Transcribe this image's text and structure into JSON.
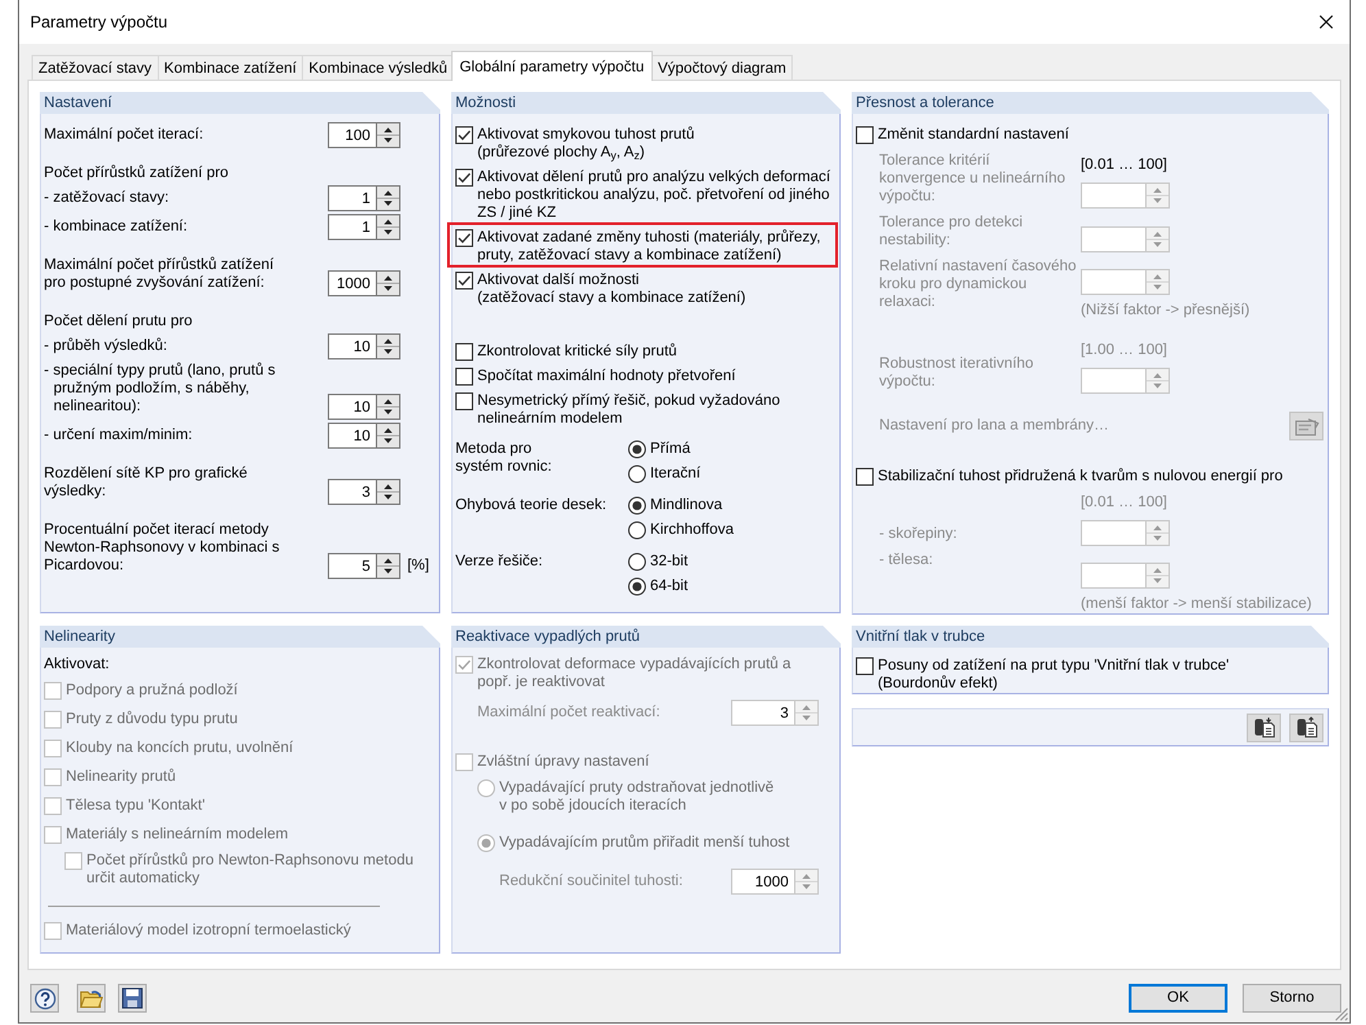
{
  "window": {
    "title": "Parametry výpočtu"
  },
  "tabs": [
    {
      "label": "Zatěžovací stavy",
      "selected": false
    },
    {
      "label": "Kombinace zatížení",
      "selected": false
    },
    {
      "label": "Kombinace výsledků",
      "selected": false
    },
    {
      "label": "Globální parametry výpočtu",
      "selected": true
    },
    {
      "label": "Výpočtový diagram",
      "selected": false
    }
  ],
  "settings": {
    "title": "Nastavení",
    "groups": [
      [
        {
          "kind": "spin",
          "label": "Maximální počet iterací:",
          "value": "100"
        }
      ],
      [
        {
          "kind": "heading",
          "label": "Počet přírůstků zatížení pro"
        },
        {
          "kind": "spin",
          "label": "- zatěžovací stavy:",
          "value": "1"
        },
        {
          "kind": "spin",
          "label": "- kombinace zatížení:",
          "value": "1"
        }
      ],
      [
        {
          "kind": "spin",
          "label": "Maximální počet přírůstků zatížení\npro postupné zvyšování zatížení:",
          "value": "1000"
        }
      ],
      [
        {
          "kind": "heading",
          "label": "Počet dělení prutu pro"
        },
        {
          "kind": "spin",
          "label": "- průběh výsledků:",
          "value": "10"
        },
        {
          "kind": "spin",
          "label": "- speciální typy prutů (lano, prutů s\npružným podložím, s náběhy,\nnelinearitou):",
          "value": "10",
          "hanging": true
        },
        {
          "kind": "spin",
          "label": "- určení maxim/minim:",
          "value": "10"
        }
      ],
      [
        {
          "kind": "spin",
          "label": "Rozdělení sítě KP pro grafické\nvýsledky:",
          "value": "3"
        }
      ],
      [
        {
          "kind": "spin",
          "label": "Procentuální počet iterací metody\nNewton-Raphsonovy v kombinaci s\nPicardovou:",
          "value": "5",
          "unit": "[%]"
        }
      ]
    ]
  },
  "options": {
    "title": "Možnosti",
    "checkbox_groups": [
      [
        {
          "label": "Aktivovat smykovou tuhost prutů\n(průřezové plochy A$_{y}$, A$_{z}$)",
          "checked": true,
          "highlighted": false
        },
        {
          "label": "Aktivovat dělení prutů pro analýzu velkých deformací\nnebo postkritickou analýzu, poč. přetvoření od jiného\nZS / jiné KZ",
          "checked": true,
          "highlighted": false
        },
        {
          "label": "Aktivovat zadané změny tuhosti (materiály, průřezy,\npruty, zatěžovací stavy a kombinace zatížení)",
          "checked": true,
          "highlighted": true
        },
        {
          "label": "Aktivovat další možnosti\n(zatěžovací stavy a kombinace zatížení)",
          "checked": true,
          "highlighted": false
        }
      ],
      [
        {
          "label": "Zkontrolovat kritické síly prutů",
          "checked": false,
          "highlighted": false
        },
        {
          "label": "Spočítat maximální hodnoty přetvoření",
          "checked": false,
          "highlighted": false
        },
        {
          "label": "Nesymetrický přímý řešič, pokud vyžadováno\nnelineárním modelem",
          "checked": false,
          "highlighted": false
        }
      ]
    ],
    "radio_groups": [
      {
        "label": "Metoda pro\nsystém rovnic:",
        "options": [
          {
            "label": "Přímá",
            "selected": true
          },
          {
            "label": "Iterační",
            "selected": false
          }
        ]
      },
      {
        "label": "Ohybová teorie desek:",
        "options": [
          {
            "label": "Mindlinova",
            "selected": true
          },
          {
            "label": "Kirchhoffova",
            "selected": false
          }
        ]
      },
      {
        "label": "Verze řešiče:",
        "options": [
          {
            "label": "32-bit",
            "selected": false
          },
          {
            "label": "64-bit",
            "selected": true
          }
        ]
      }
    ]
  },
  "precision": {
    "title": "Přesnost a tolerance",
    "items": [
      {
        "kind": "checkbox",
        "label": "Změnit standardní nastavení",
        "checked": false,
        "disabled": false,
        "children": [
          {
            "kind": "field",
            "label": "Tolerance kritérií\nkonvergence u nelineárního\nvýpočtu:",
            "range": "[0.01 … 100]",
            "range_disabled": false,
            "disabled": true
          },
          {
            "kind": "field",
            "label": "Tolerance pro detekci\nnestability:",
            "disabled": true
          },
          {
            "kind": "field",
            "label": "Relativní nastavení časového\nkroku pro dynamickou\nrelaxaci:",
            "note": "(Nižší faktor -> přesnější)",
            "disabled": true
          },
          {
            "kind": "field",
            "label": "Robustnost iterativního\nvýpočtu:",
            "range": "[1.00 … 100]",
            "range_disabled": true,
            "disabled": true
          },
          {
            "kind": "button",
            "label": "Nastavení pro lana a membrány…",
            "disabled": true
          }
        ]
      },
      {
        "kind": "checkbox",
        "label": "Stabilizační tuhost přidružená k tvarům s nulovou energií pro",
        "checked": false,
        "disabled": false,
        "children": [
          {
            "kind": "field",
            "label": "- skořepiny:",
            "range": "[0.01 … 100]",
            "range_disabled": true,
            "disabled": true
          },
          {
            "kind": "field",
            "label": "- tělesa:",
            "note": "(menší faktor -> menší stabilizace)",
            "disabled": true
          }
        ]
      }
    ]
  },
  "nonlinearity": {
    "title": "Nelinearity",
    "caption": "Aktivovat:",
    "groups": [
      [
        {
          "label": "Podpory a pružná podloží",
          "checked": false,
          "disabled": true
        },
        {
          "label": "Pruty z důvodu typu prutu",
          "checked": false,
          "disabled": true
        },
        {
          "label": "Klouby na koncích prutu, uvolnění",
          "checked": false,
          "disabled": true
        },
        {
          "label": "Nelinearity prutů",
          "checked": false,
          "disabled": true
        },
        {
          "label": "Tělesa typu 'Kontakt'",
          "checked": false,
          "disabled": true
        },
        {
          "label": "Materiály s nelineárním modelem",
          "checked": false,
          "disabled": true,
          "children": [
            {
              "label": "Počet přírůstků pro Newton-Raphsonovu metodu\nurčit automaticky",
              "checked": false,
              "disabled": true
            }
          ]
        }
      ],
      [
        {
          "label": "Materiálový model izotropní termoelastický",
          "checked": false,
          "disabled": true
        }
      ]
    ]
  },
  "reactivation": {
    "title": "Reaktivace vypadlých prutů",
    "items": [
      {
        "kind": "checkbox",
        "label": "Zkontrolovat deformace vypadávajících prutů a\npopř. je reaktivovat",
        "checked": true,
        "disabled": true,
        "children": [
          {
            "kind": "spin",
            "label": "Maximální počet reaktivací:",
            "value": "3",
            "disabled": true
          }
        ]
      },
      {
        "kind": "checkbox",
        "label": "Zvláštní úpravy nastavení",
        "checked": false,
        "disabled": true,
        "children": [
          {
            "kind": "radio",
            "label": "Vypadávající pruty odstraňovat jednotlivě\nv po sobě jdoucích iteracích",
            "selected": false,
            "disabled": true
          },
          {
            "kind": "radio",
            "label": "Vypadávajícím prutům přiřadit menší tuhost",
            "selected": true,
            "disabled": true,
            "children": [
              {
                "kind": "spin",
                "label": "Redukční součinitel tuhosti:",
                "value": "1000",
                "disabled": true
              }
            ]
          }
        ]
      }
    ]
  },
  "pipe_pressure": {
    "title": "Vnitřní tlak v trubce",
    "items": [
      {
        "label": "Posuny od zatížení na prut typu 'Vnitřní tlak v trubce'\n(Bourdonův efekt)",
        "checked": false,
        "disabled": false
      }
    ]
  },
  "footer": {
    "buttons": [
      {
        "label": "OK",
        "default": true
      },
      {
        "label": "Storno",
        "default": false
      }
    ]
  }
}
